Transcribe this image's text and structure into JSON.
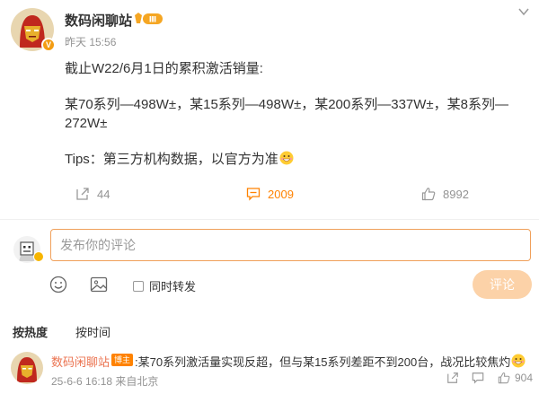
{
  "post": {
    "author": "数码闲聊站",
    "vip_badge": "Ⅲ",
    "verified_badge": "V",
    "time": "昨天 15:56",
    "lines": [
      "截止W22/6月1日的累积激活销量:",
      "某70系列—498W±，某15系列—498W±，某200系列—337W±，某8系列—272W±",
      "Tips：第三方机构数据，以官方为准"
    ]
  },
  "actions": {
    "forward_count": "44",
    "comment_count": "2009",
    "like_count": "8992"
  },
  "composer": {
    "placeholder": "发布你的评论",
    "repost_label": "同时转发",
    "submit_label": "评论"
  },
  "sort": {
    "hot": "按热度",
    "time": "按时间"
  },
  "comment": {
    "author": "数码闲聊站",
    "tag": "博主",
    "text": ":某70系列激活量实现反超，但与某15系列差距不到200台，战况比较焦灼",
    "meta": "25-6-6 16:18 来自北京",
    "like_count": "904"
  },
  "colors": {
    "accent": "#ff8200",
    "name_link": "#eb7350",
    "submit_disabled": "#fcd2a8"
  },
  "icons": [
    "iron-man-avatar-icon",
    "vip-badge-icon",
    "chevron-down-icon",
    "forward-icon",
    "comment-icon",
    "like-icon",
    "emoji-icon",
    "image-icon",
    "grin-emoji-icon"
  ]
}
